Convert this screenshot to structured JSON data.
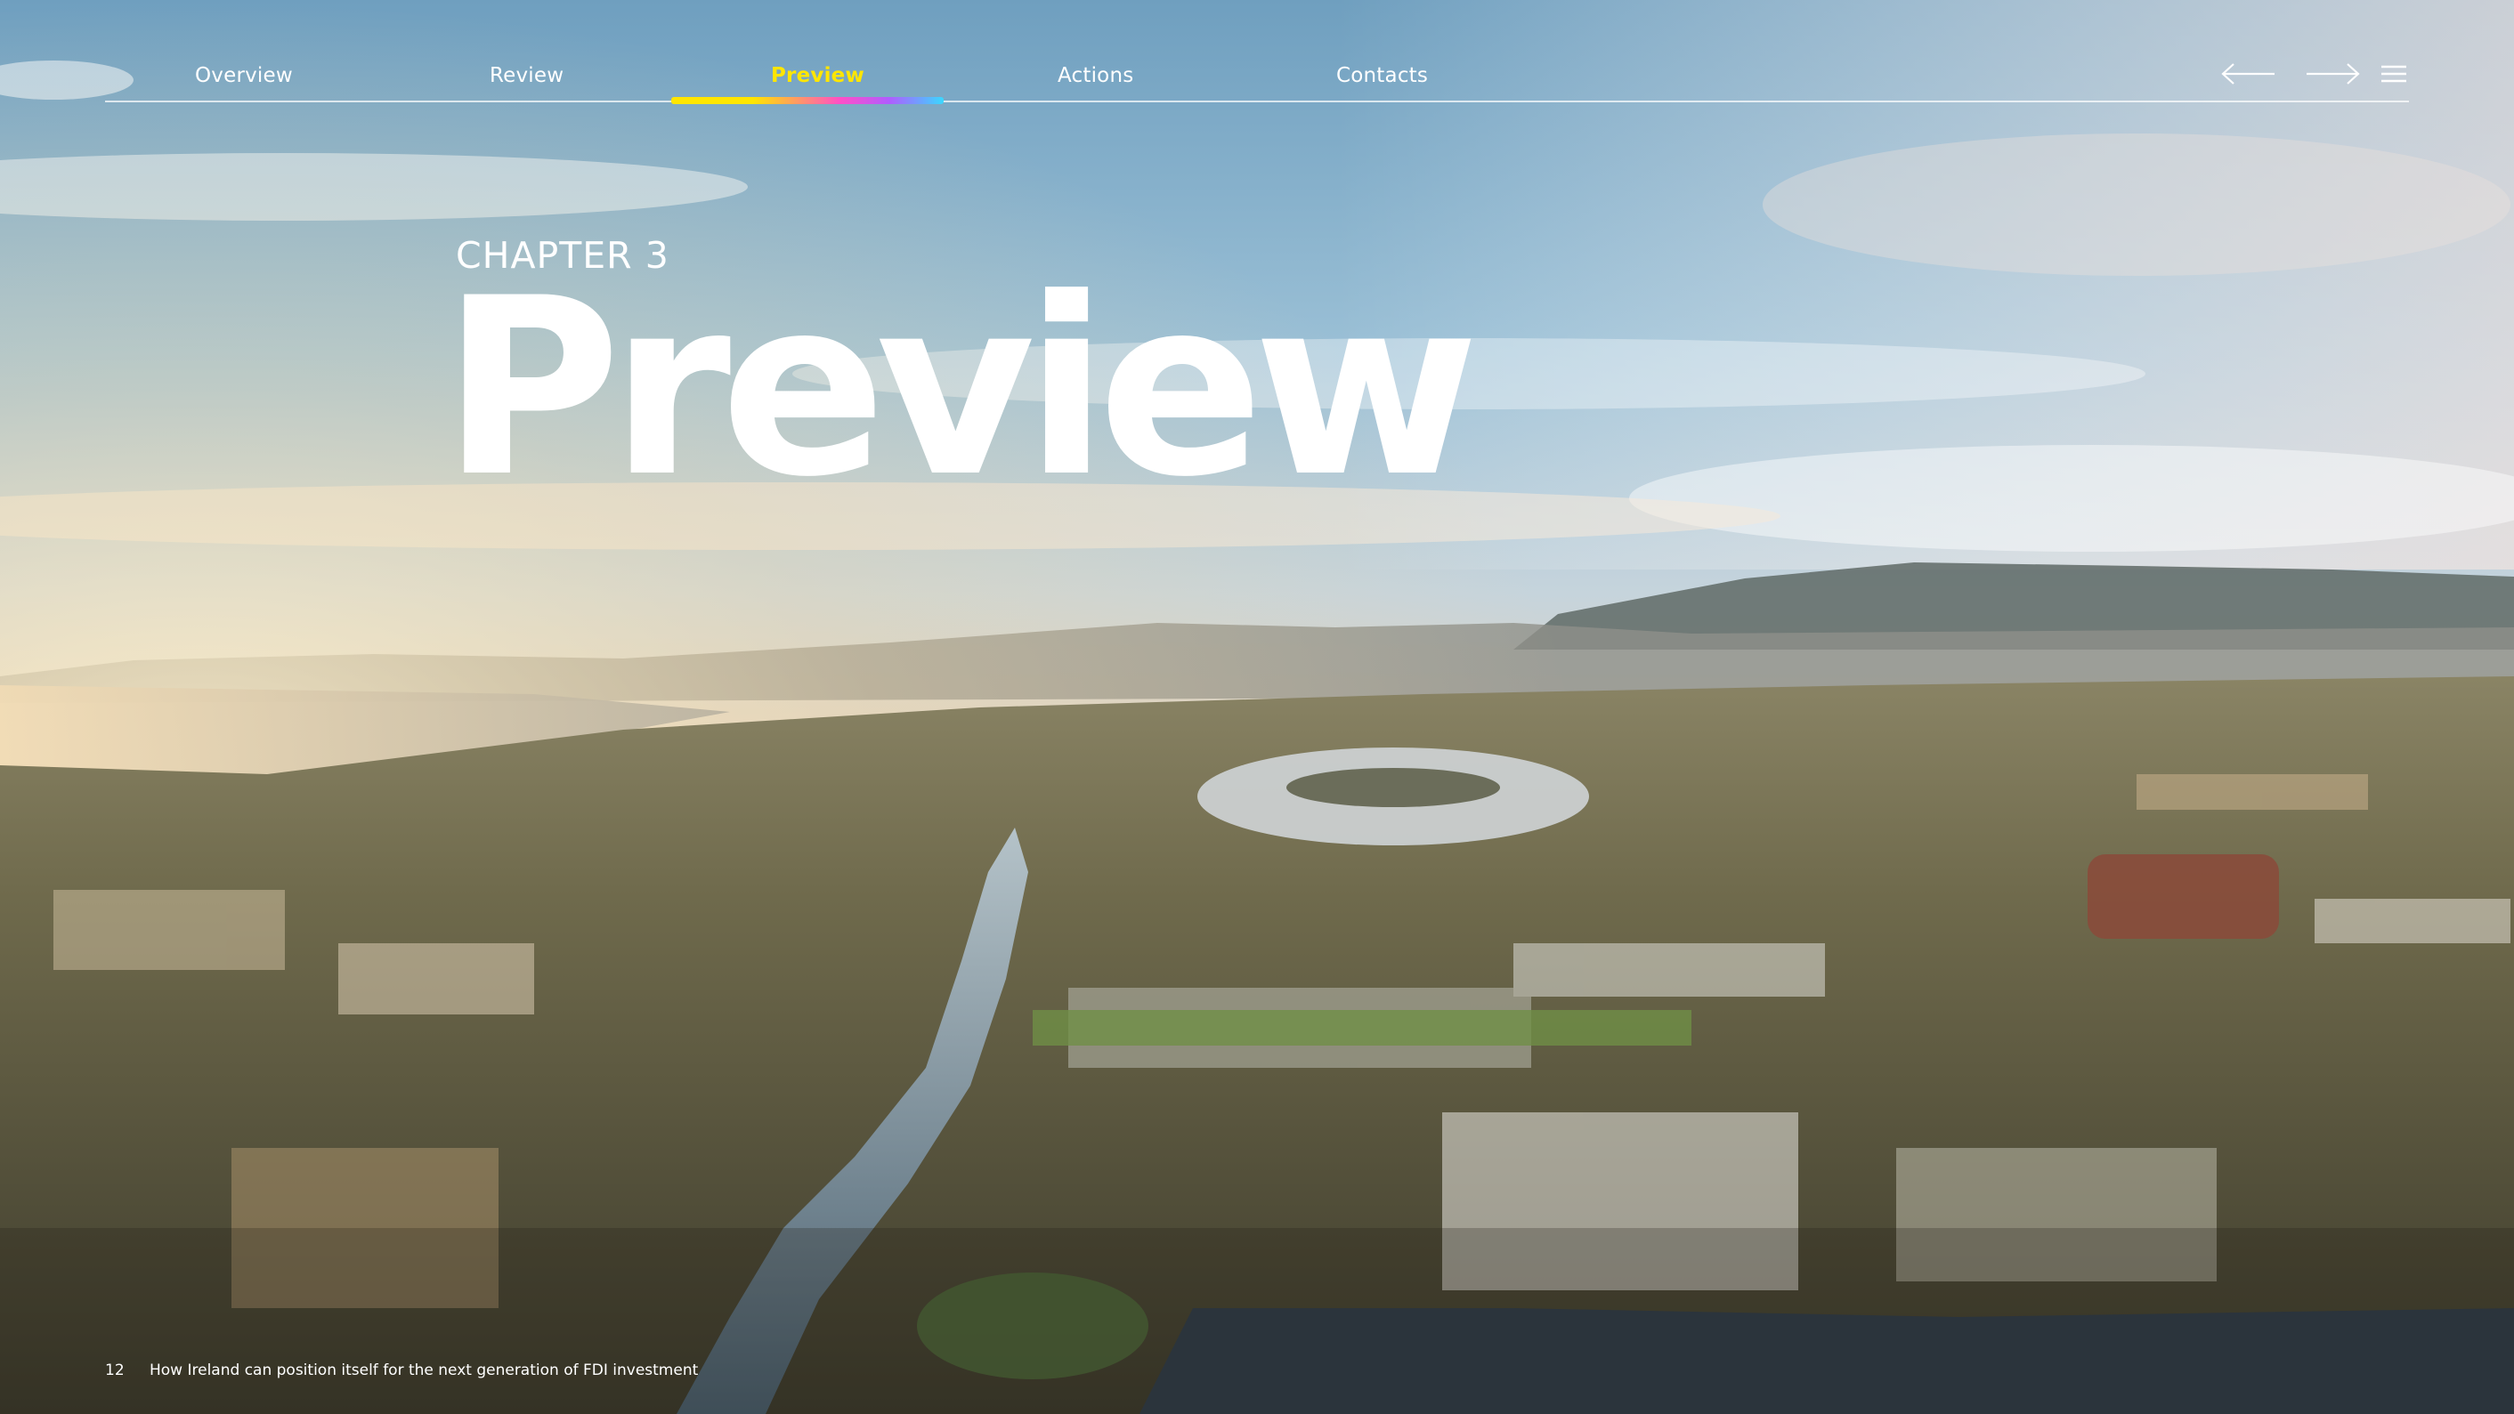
{
  "navigation": {
    "items": [
      {
        "label": "Overview",
        "active": false
      },
      {
        "label": "Review",
        "active": false
      },
      {
        "label": "Preview",
        "active": true
      },
      {
        "label": "Actions",
        "active": false
      },
      {
        "label": "Contacts",
        "active": false
      }
    ],
    "active_color": "#ffe600",
    "active_bar_gradient": [
      "#ffe600",
      "#ff4fc7",
      "#b05cff",
      "#3ad8ff"
    ],
    "icons": {
      "previous": "arrow-left-icon",
      "next": "arrow-right-icon",
      "menu": "hamburger-menu-icon"
    }
  },
  "chapter": {
    "label": "CHAPTER 3",
    "title": "Preview"
  },
  "background": {
    "image": "aerial-city-skyline-photo"
  },
  "footer": {
    "page_number": "12",
    "publication_title": "How Ireland can position itself for the next generation of FDI investment"
  }
}
